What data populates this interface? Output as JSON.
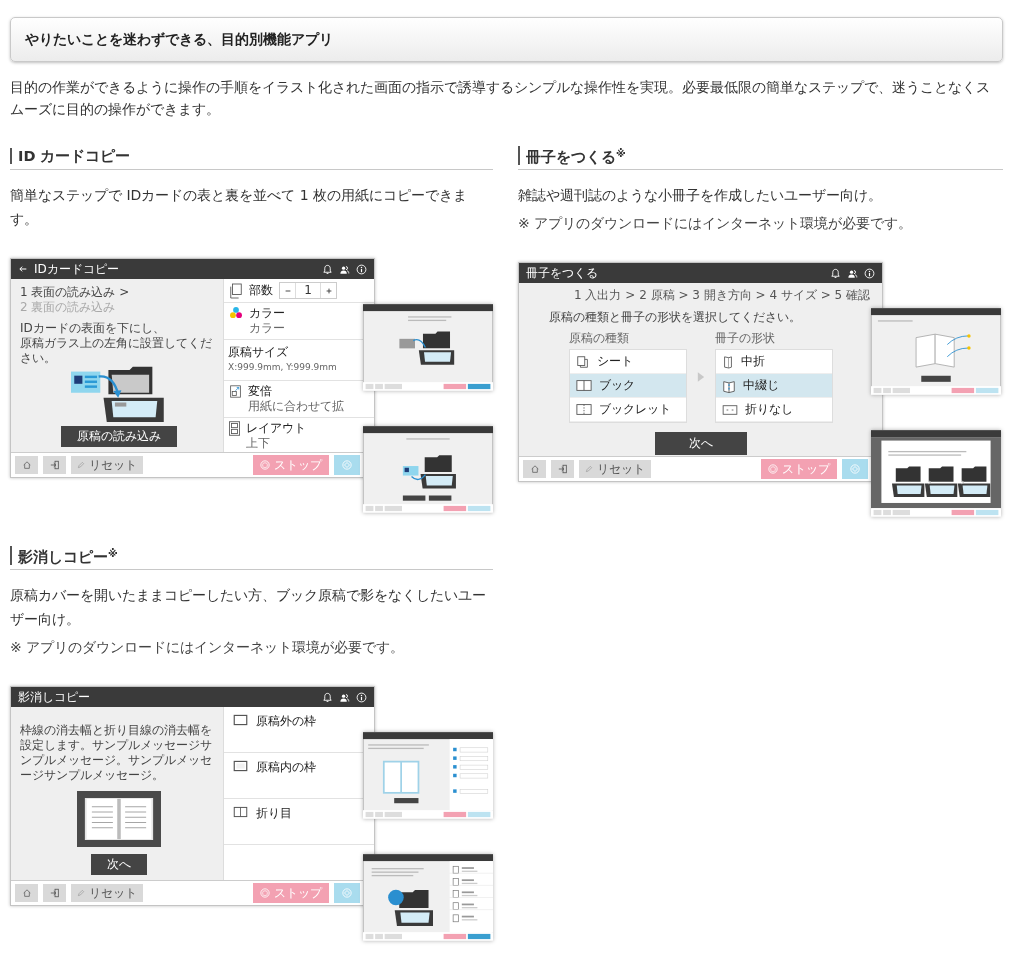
{
  "banner": {
    "title": "やりたいことを迷わずできる、目的別機能アプリ"
  },
  "intro": "目的の作業ができるように操作の手順をイラスト化された画面の指示で誘導するシンプルな操作性を実現。必要最低限の簡単なステップで、迷うことなくスムーズに目的の操作ができます。",
  "sections": [
    {
      "title": "ID カードコピー",
      "description": "簡単なステップで IDカードの表と裏を並べて 1 枚の用紙にコピーできます。",
      "screen": {
        "kind": "id-card",
        "title": "IDカードコピー",
        "steps": [
          {
            "label": "1 表面の読み込み >",
            "active": true
          },
          {
            "label": "2 裏面の読み込み",
            "active": false
          }
        ],
        "message": [
          "IDカードの表面を下にし、",
          "原稿ガラス上の左角に設置してください。"
        ],
        "action": "原稿の読み込み",
        "settings": [
          {
            "kind": "counter",
            "label": "部数",
            "value": "1"
          },
          {
            "kind": "setting",
            "label": "カラー",
            "value": "カラー"
          },
          {
            "kind": "plain",
            "label": "原稿サイズ",
            "value": "X:999.9mm, Y:999.9mm"
          },
          {
            "kind": "setting",
            "label": "変倍",
            "value": "用紙に合わせて拡"
          },
          {
            "kind": "setting",
            "label": "レイアウト",
            "value": "上下"
          }
        ],
        "footer": {
          "reset": "リセット",
          "stop": "ストップ"
        }
      },
      "previews": [
        {
          "kind": "card-scan"
        },
        {
          "kind": "card-flip"
        }
      ]
    },
    {
      "title": "冊子をつくる$^{※}$",
      "description": "雑誌や週刊誌のような小冊子を作成したいユーザー向け。",
      "note": "※ アプリのダウンロードにはインターネット環境が必要です。",
      "screen": {
        "kind": "booklet",
        "title": "冊子をつくる",
        "breadcrumb": "1 入出力 > 2 原稿 > 3 開き方向 > 4 サイズ > 5 確認",
        "message": [
          "原稿の種類と冊子の形状を選択してください。"
        ],
        "lists": [
          {
            "label": "原稿の種類",
            "options": [
              {
                "label": "シート",
                "selected": false
              },
              {
                "label": "ブック",
                "selected": true
              },
              {
                "label": "ブックレット",
                "selected": false
              }
            ]
          },
          {
            "label": "冊子の形状",
            "options": [
              {
                "label": "中折",
                "selected": false
              },
              {
                "label": "中綴じ",
                "selected": true
              },
              {
                "label": "折りなし",
                "selected": false
              }
            ]
          }
        ],
        "action": "次へ",
        "footer": {
          "reset": "リセット",
          "stop": "ストップ"
        }
      },
      "previews": [
        {
          "kind": "book-pages"
        },
        {
          "kind": "book-guide"
        }
      ]
    },
    {
      "title": "影消しコピー$^{※}$",
      "description": "原稿カバーを開いたままコピーしたい方、ブック原稿で影をなくしたいユーザー向け。",
      "note": "※ アプリのダウンロードにはインターネット環境が必要です。",
      "screen": {
        "kind": "erase",
        "title": "影消しコピー",
        "message": [
          "枠線の消去幅と折り目線の消去幅を設定します。サンプルメッセージサンプルメッセージ。サンプルメッセージサンプルメッセージ。"
        ],
        "action": "次へ",
        "settings": [
          {
            "kind": "option",
            "label": "原稿外の枠"
          },
          {
            "kind": "option",
            "label": "原稿内の枠"
          },
          {
            "kind": "option",
            "label": "折り目"
          }
        ],
        "footer": {
          "reset": "リセット",
          "stop": "ストップ"
        }
      },
      "previews": [
        {
          "kind": "margin-settings"
        },
        {
          "kind": "scanner-settings"
        }
      ]
    }
  ]
}
